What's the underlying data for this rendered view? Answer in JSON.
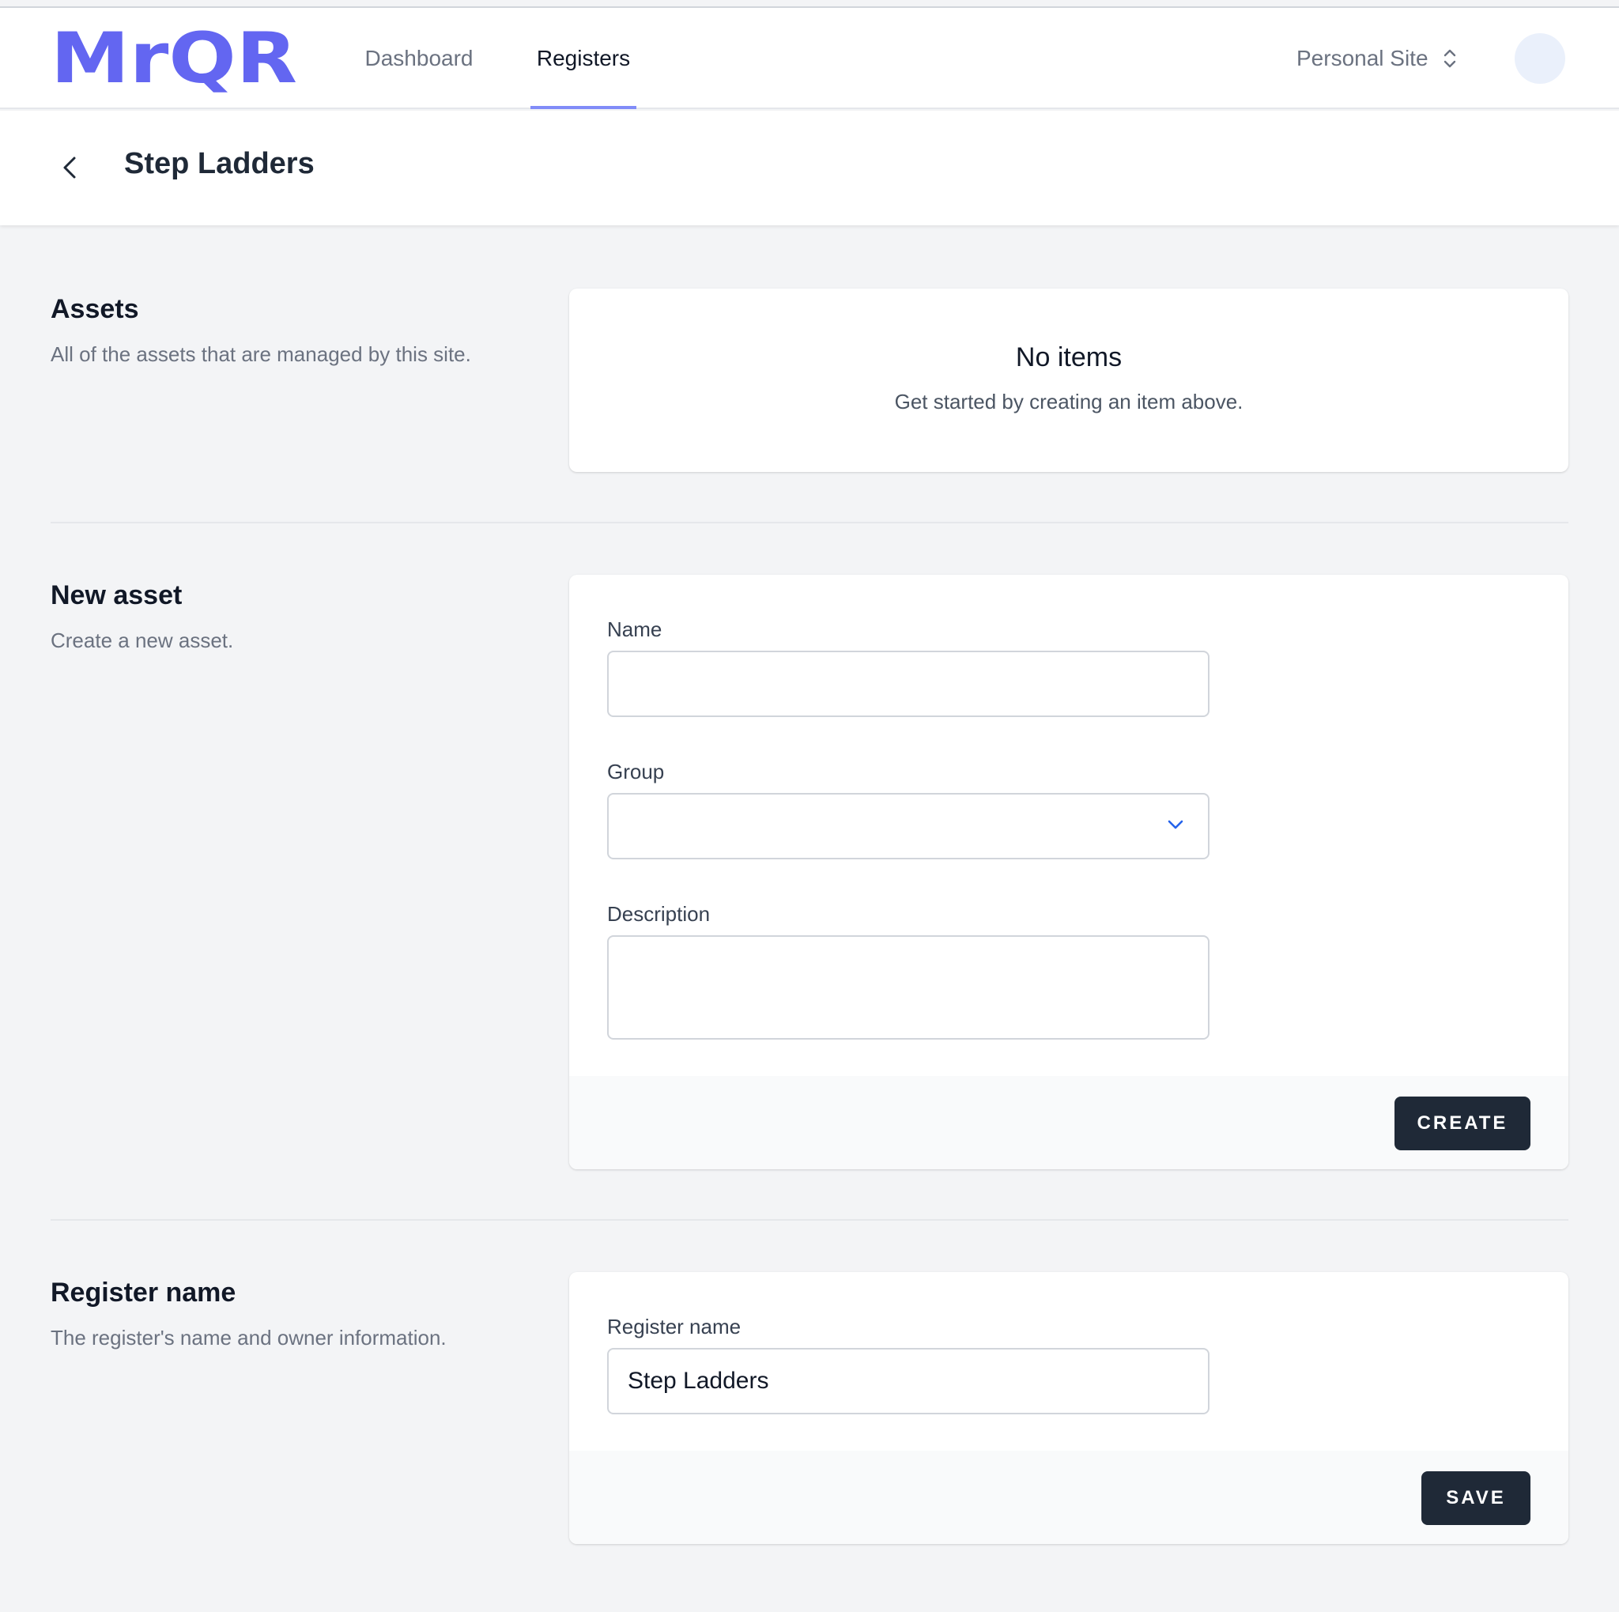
{
  "header": {
    "logo_text": "MrQR",
    "brand_color": "#6366f1",
    "nav": [
      {
        "label": "Dashboard",
        "active": false
      },
      {
        "label": "Registers",
        "active": true
      }
    ],
    "site_selector": "Personal Site"
  },
  "page": {
    "title": "Step Ladders"
  },
  "assets_section": {
    "title": "Assets",
    "description": "All of the assets that are managed by this site.",
    "empty_title": "No items",
    "empty_description": "Get started by creating an item above."
  },
  "new_asset_section": {
    "title": "New asset",
    "description": "Create a new asset.",
    "name_label": "Name",
    "name_value": "",
    "group_label": "Group",
    "group_value": "",
    "description_label": "Description",
    "description_value": "",
    "create_button": "CREATE"
  },
  "register_section": {
    "title": "Register name",
    "description": "The register's name and owner information.",
    "field_label": "Register name",
    "field_value": "Step Ladders",
    "save_button": "SAVE"
  }
}
